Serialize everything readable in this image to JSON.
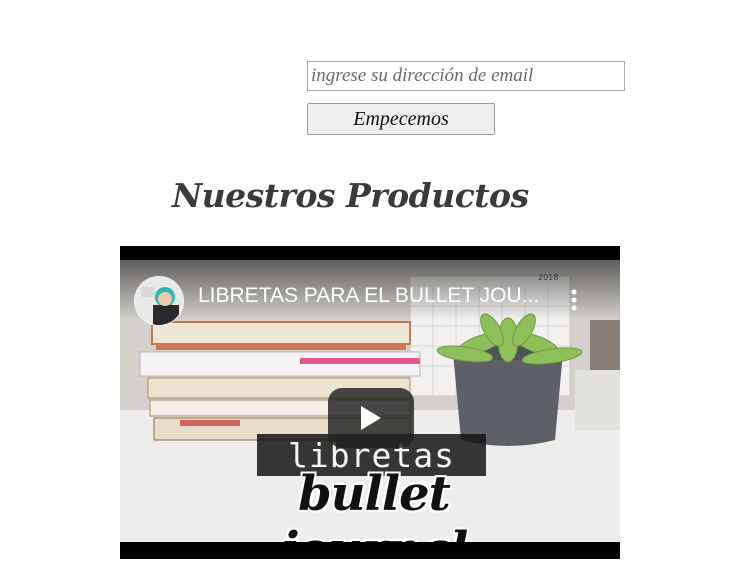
{
  "signup": {
    "email_placeholder": "ingrese su dirección de email",
    "email_value": "",
    "submit_label": "Empecemos"
  },
  "products": {
    "heading": "Nuestros Productos"
  },
  "video": {
    "title": "LIBRETAS PARA EL BULLET JOU...",
    "caption_line1": "libretas",
    "caption_line2": "bullet journal",
    "calendar_year": "2018",
    "play_icon": "play-icon",
    "menu_icon": "more-vert-icon"
  },
  "colors": {
    "heading": "#3a3a3a",
    "video_bg": "#000000",
    "play_button": "#212121"
  }
}
